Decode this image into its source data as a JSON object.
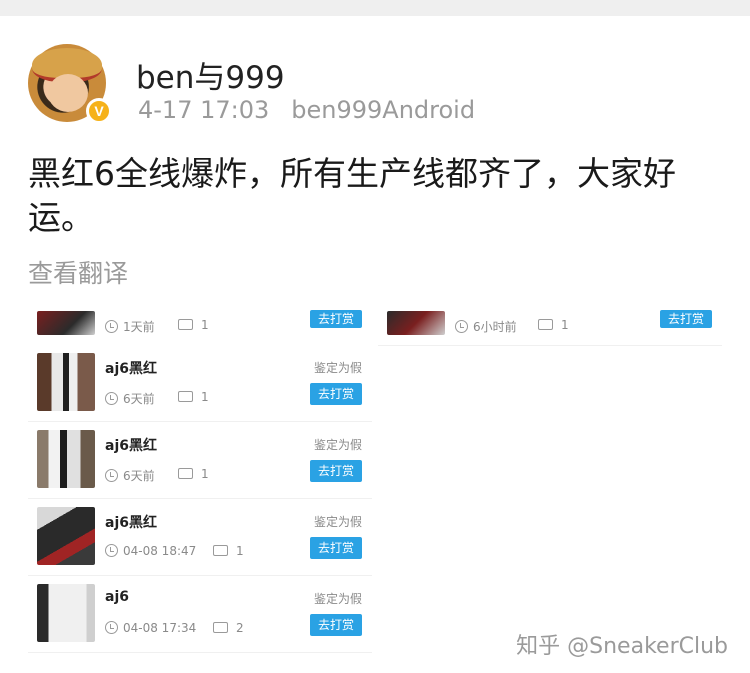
{
  "header": {
    "username": "ben与999",
    "time": "4-17 17:03",
    "source": "ben999Android",
    "verified_badge": "V"
  },
  "post": {
    "text": "黑红6全线爆炸，所有生产线都齐了，大家好运。",
    "translate_label": "查看翻译"
  },
  "cards": [
    {
      "title": "",
      "time": "1天前",
      "comments": "1",
      "verdict": "",
      "tip_label": "去打赏"
    },
    {
      "title": "",
      "time": "6小时前",
      "comments": "1",
      "verdict": "",
      "tip_label": "去打赏"
    },
    {
      "title": "aj6黑红",
      "time": "6天前",
      "comments": "1",
      "verdict": "鉴定为假",
      "tip_label": "去打赏"
    },
    {
      "title": "aj6黑红",
      "time": "6天前",
      "comments": "1",
      "verdict": "鉴定为假",
      "tip_label": "去打赏"
    },
    {
      "title": "aj6黑红",
      "time": "04-08 18:47",
      "comments": "1",
      "verdict": "鉴定为假",
      "tip_label": "去打赏"
    },
    {
      "title": "aj6",
      "time": "04-08 17:34",
      "comments": "2",
      "verdict": "鉴定为假",
      "tip_label": "去打赏"
    }
  ],
  "watermark": {
    "text": "知乎 @SneakerClub"
  }
}
